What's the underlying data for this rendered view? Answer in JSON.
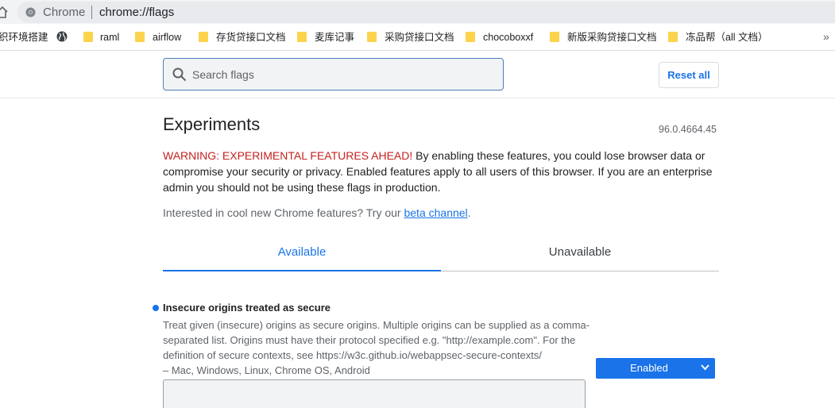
{
  "omnibox": {
    "site_name": "Chrome",
    "url": "chrome://flags"
  },
  "bookmarks": [
    {
      "label": "织环境搭建",
      "icon": "none"
    },
    {
      "label": "",
      "icon": "globe-icon"
    },
    {
      "label": "raml",
      "icon": "folder-icon"
    },
    {
      "label": "airflow",
      "icon": "folder-icon"
    },
    {
      "label": "存货贷接口文档",
      "icon": "folder-icon"
    },
    {
      "label": "麦库记事",
      "icon": "folder-icon"
    },
    {
      "label": "采购贷接口文档",
      "icon": "folder-icon"
    },
    {
      "label": "chocoboxxf",
      "icon": "folder-icon"
    },
    {
      "label": "新版采购贷接口文档",
      "icon": "folder-icon"
    },
    {
      "label": "冻品帮（all 文档）",
      "icon": "folder-icon"
    }
  ],
  "search": {
    "placeholder": "Search flags",
    "value": ""
  },
  "reset_button": "Reset all",
  "page": {
    "title": "Experiments",
    "version": "96.0.4664.45",
    "warning_label": "WARNING: EXPERIMENTAL FEATURES AHEAD!",
    "warning_text": " By enabling these features, you could lose browser data or compromise your security or privacy. Enabled features apply to all users of this browser. If you are an enterprise admin you should not be using these flags in production.",
    "interested_prefix": "Interested in cool new Chrome features? Try our ",
    "beta_link": "beta channel",
    "interested_suffix": "."
  },
  "tabs": [
    {
      "label": "Available",
      "active": true
    },
    {
      "label": "Unavailable",
      "active": false
    }
  ],
  "experiment": {
    "name": "Insecure origins treated as secure",
    "description": "Treat given (insecure) origins as secure origins. Multiple origins can be supplied as a comma-separated list. Origins must have their protocol specified e.g. \"http://example.com\". For the definition of secure contexts, see https://w3c.github.io/webappsec-secure-contexts/",
    "platforms": "– Mac, Windows, Linux, Chrome OS, Android",
    "state": "Enabled",
    "origins_value": ""
  },
  "colors": {
    "accent": "#1a73e8",
    "warning": "#c5221f",
    "folder": "#fcd34d"
  }
}
